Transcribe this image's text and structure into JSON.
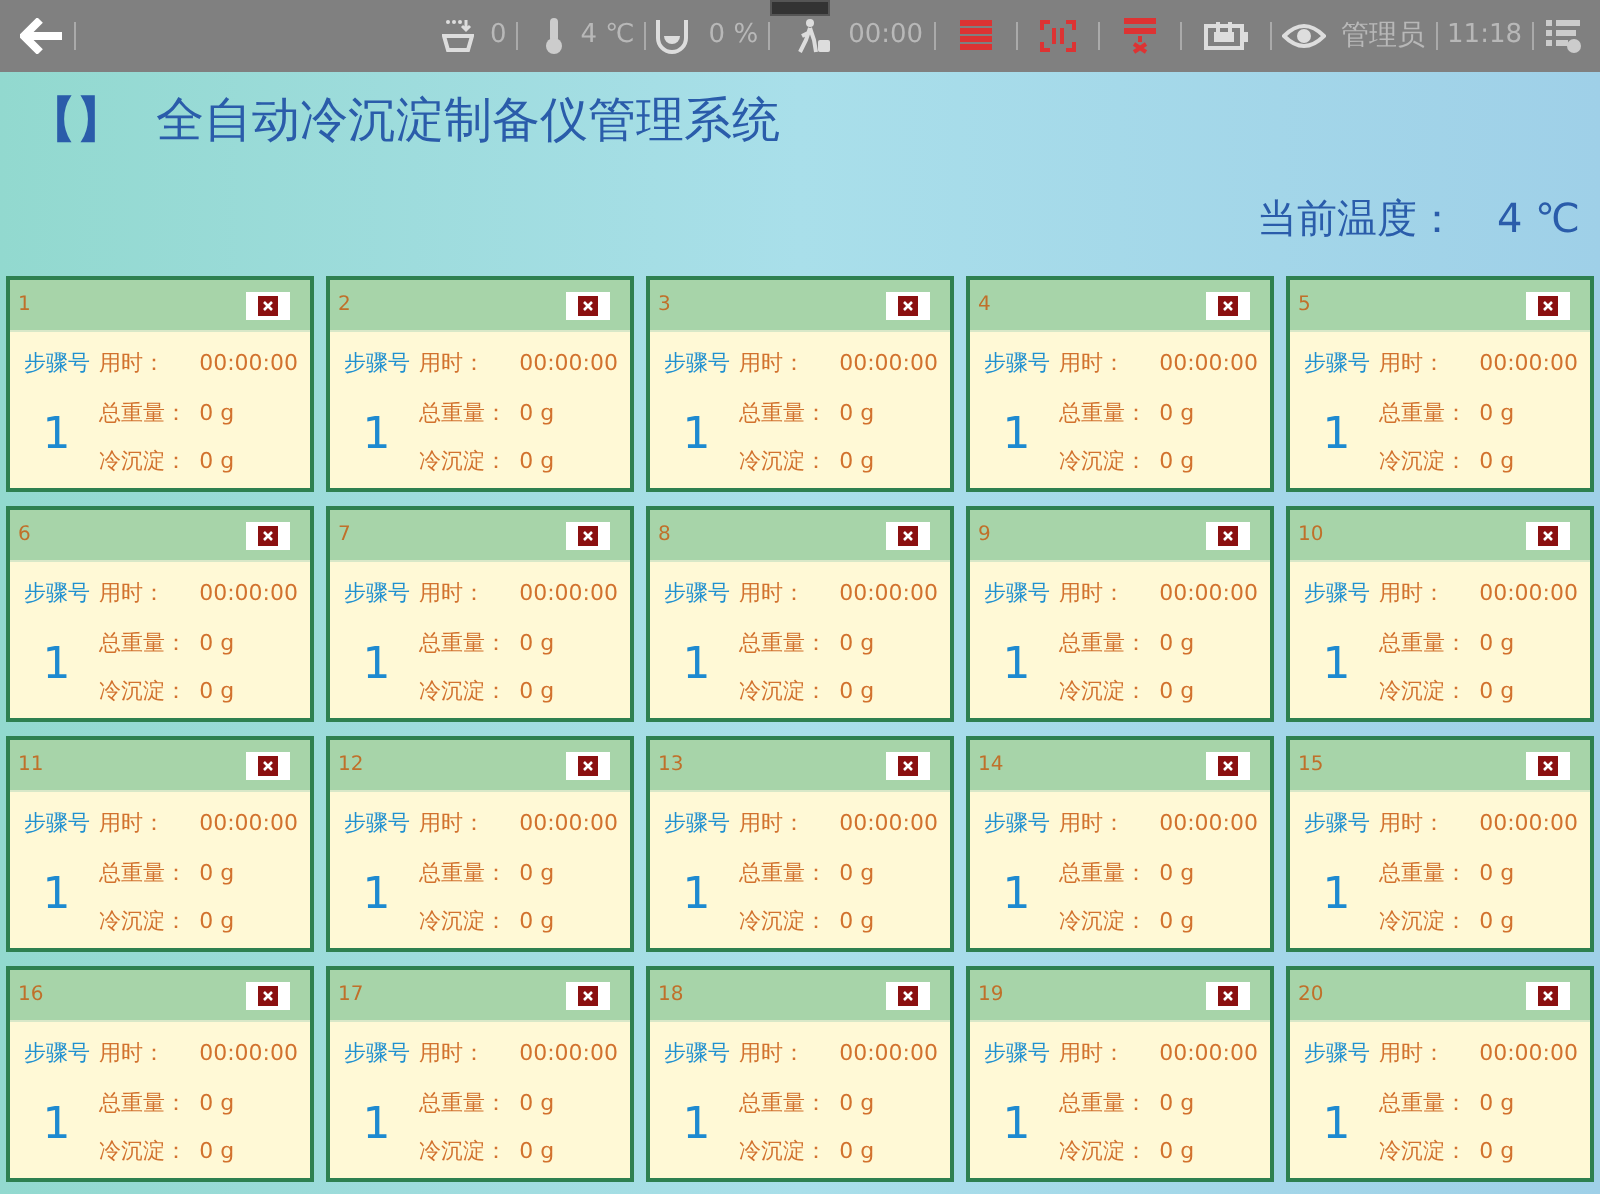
{
  "status_bar": {
    "basin_count": "0",
    "temperature": "4 ℃",
    "fill": "0 %",
    "elapsed": "00:00",
    "user": "管理员",
    "clock": "11:18"
  },
  "header": {
    "bracket": "【】",
    "title": "全自动冷沉淀制备仪管理系统",
    "temperature_label": "当前温度：",
    "temperature": "4 ℃"
  },
  "cards": [
    {
      "number": "1",
      "step_label": "步骤号",
      "step": "1",
      "time_label": "用时：",
      "time": "00:00:00",
      "weight_label": "总重量：",
      "weight": "0 g",
      "sediment_label": "冷沉淀：",
      "sediment": "0 g"
    },
    {
      "number": "2",
      "step_label": "步骤号",
      "step": "1",
      "time_label": "用时：",
      "time": "00:00:00",
      "weight_label": "总重量：",
      "weight": "0 g",
      "sediment_label": "冷沉淀：",
      "sediment": "0 g"
    },
    {
      "number": "3",
      "step_label": "步骤号",
      "step": "1",
      "time_label": "用时：",
      "time": "00:00:00",
      "weight_label": "总重量：",
      "weight": "0 g",
      "sediment_label": "冷沉淀：",
      "sediment": "0 g"
    },
    {
      "number": "4",
      "step_label": "步骤号",
      "step": "1",
      "time_label": "用时：",
      "time": "00:00:00",
      "weight_label": "总重量：",
      "weight": "0 g",
      "sediment_label": "冷沉淀：",
      "sediment": "0 g"
    },
    {
      "number": "5",
      "step_label": "步骤号",
      "step": "1",
      "time_label": "用时：",
      "time": "00:00:00",
      "weight_label": "总重量：",
      "weight": "0 g",
      "sediment_label": "冷沉淀：",
      "sediment": "0 g"
    },
    {
      "number": "6",
      "step_label": "步骤号",
      "step": "1",
      "time_label": "用时：",
      "time": "00:00:00",
      "weight_label": "总重量：",
      "weight": "0 g",
      "sediment_label": "冷沉淀：",
      "sediment": "0 g"
    },
    {
      "number": "7",
      "step_label": "步骤号",
      "step": "1",
      "time_label": "用时：",
      "time": "00:00:00",
      "weight_label": "总重量：",
      "weight": "0 g",
      "sediment_label": "冷沉淀：",
      "sediment": "0 g"
    },
    {
      "number": "8",
      "step_label": "步骤号",
      "step": "1",
      "time_label": "用时：",
      "time": "00:00:00",
      "weight_label": "总重量：",
      "weight": "0 g",
      "sediment_label": "冷沉淀：",
      "sediment": "0 g"
    },
    {
      "number": "9",
      "step_label": "步骤号",
      "step": "1",
      "time_label": "用时：",
      "time": "00:00:00",
      "weight_label": "总重量：",
      "weight": "0 g",
      "sediment_label": "冷沉淀：",
      "sediment": "0 g"
    },
    {
      "number": "10",
      "step_label": "步骤号",
      "step": "1",
      "time_label": "用时：",
      "time": "00:00:00",
      "weight_label": "总重量：",
      "weight": "0 g",
      "sediment_label": "冷沉淀：",
      "sediment": "0 g"
    },
    {
      "number": "11",
      "step_label": "步骤号",
      "step": "1",
      "time_label": "用时：",
      "time": "00:00:00",
      "weight_label": "总重量：",
      "weight": "0 g",
      "sediment_label": "冷沉淀：",
      "sediment": "0 g"
    },
    {
      "number": "12",
      "step_label": "步骤号",
      "step": "1",
      "time_label": "用时：",
      "time": "00:00:00",
      "weight_label": "总重量：",
      "weight": "0 g",
      "sediment_label": "冷沉淀：",
      "sediment": "0 g"
    },
    {
      "number": "13",
      "step_label": "步骤号",
      "step": "1",
      "time_label": "用时：",
      "time": "00:00:00",
      "weight_label": "总重量：",
      "weight": "0 g",
      "sediment_label": "冷沉淀：",
      "sediment": "0 g"
    },
    {
      "number": "14",
      "step_label": "步骤号",
      "step": "1",
      "time_label": "用时：",
      "time": "00:00:00",
      "weight_label": "总重量：",
      "weight": "0 g",
      "sediment_label": "冷沉淀：",
      "sediment": "0 g"
    },
    {
      "number": "15",
      "step_label": "步骤号",
      "step": "1",
      "time_label": "用时：",
      "time": "00:00:00",
      "weight_label": "总重量：",
      "weight": "0 g",
      "sediment_label": "冷沉淀：",
      "sediment": "0 g"
    },
    {
      "number": "16",
      "step_label": "步骤号",
      "step": "1",
      "time_label": "用时：",
      "time": "00:00:00",
      "weight_label": "总重量：",
      "weight": "0 g",
      "sediment_label": "冷沉淀：",
      "sediment": "0 g"
    },
    {
      "number": "17",
      "step_label": "步骤号",
      "step": "1",
      "time_label": "用时：",
      "time": "00:00:00",
      "weight_label": "总重量：",
      "weight": "0 g",
      "sediment_label": "冷沉淀：",
      "sediment": "0 g"
    },
    {
      "number": "18",
      "step_label": "步骤号",
      "step": "1",
      "time_label": "用时：",
      "time": "00:00:00",
      "weight_label": "总重量：",
      "weight": "0 g",
      "sediment_label": "冷沉淀：",
      "sediment": "0 g"
    },
    {
      "number": "19",
      "step_label": "步骤号",
      "step": "1",
      "time_label": "用时：",
      "time": "00:00:00",
      "weight_label": "总重量：",
      "weight": "0 g",
      "sediment_label": "冷沉淀：",
      "sediment": "0 g"
    },
    {
      "number": "20",
      "step_label": "步骤号",
      "step": "1",
      "time_label": "用时：",
      "time": "00:00:00",
      "weight_label": "总重量：",
      "weight": "0 g",
      "sediment_label": "冷沉淀：",
      "sediment": "0 g"
    }
  ]
}
